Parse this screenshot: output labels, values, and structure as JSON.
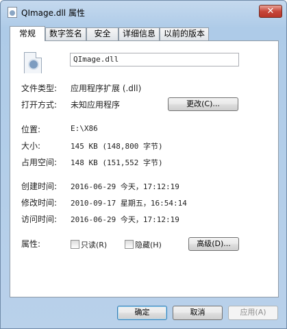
{
  "window": {
    "title": "QImage.dll 属性",
    "close_glyph": "✕"
  },
  "tabs": [
    {
      "label": "常规",
      "active": true
    },
    {
      "label": "数字签名",
      "active": false
    },
    {
      "label": "安全",
      "active": false
    },
    {
      "label": "详细信息",
      "active": false
    },
    {
      "label": "以前的版本",
      "active": false
    }
  ],
  "general": {
    "file_name": "QImage.dll",
    "file_type_label": "文件类型:",
    "file_type_value": "应用程序扩展 (.dll)",
    "open_with_label": "打开方式:",
    "open_with_value": "未知应用程序",
    "change_button": "更改(C)...",
    "location_label": "位置:",
    "location_value": "E:\\X86",
    "size_label": "大小:",
    "size_value": "145 KB (148,800 字节)",
    "size_on_disk_label": "占用空间:",
    "size_on_disk_value": "148 KB (151,552 字节)",
    "created_label": "创建时间:",
    "created_value": "2016-06-29 今天，17:12:19",
    "modified_label": "修改时间:",
    "modified_value": "2010-09-17 星期五，16:54:14",
    "accessed_label": "访问时间:",
    "accessed_value": "2016-06-29 今天，17:12:19",
    "attributes_label": "属性:",
    "readonly_label": "只读(R)",
    "hidden_label": "隐藏(H)",
    "advanced_button": "高级(D)..."
  },
  "footer": {
    "ok_button": "确定",
    "cancel_button": "取消",
    "apply_button": "应用(A)"
  }
}
